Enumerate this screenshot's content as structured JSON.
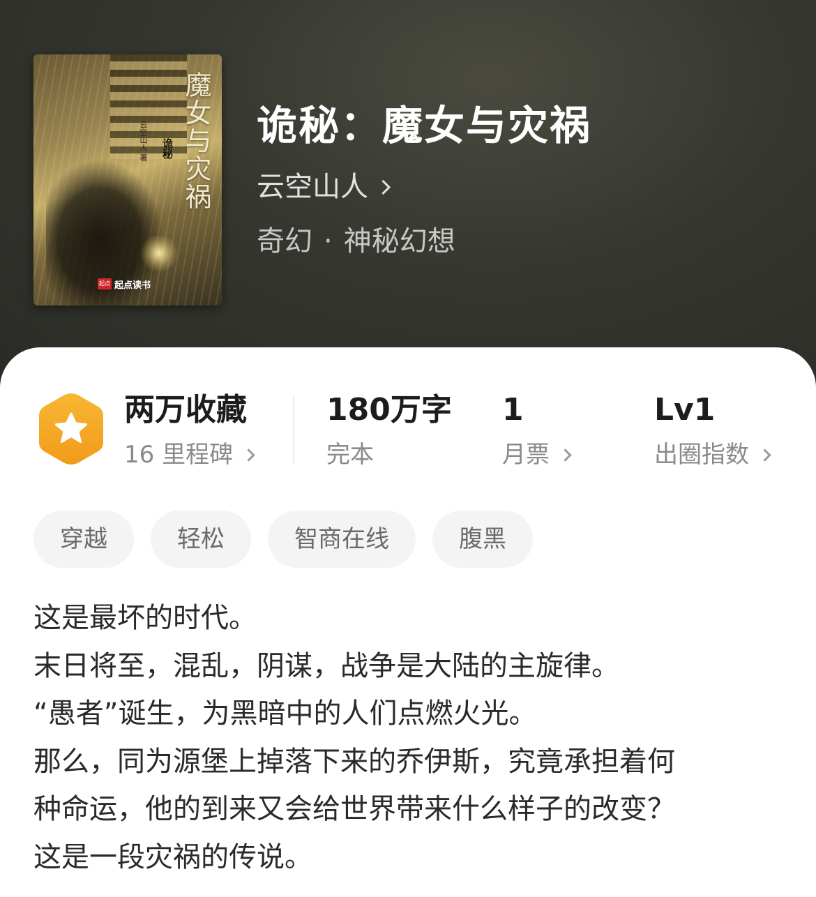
{
  "book": {
    "title": "诡秘：魔女与灾祸",
    "author": "云空山人",
    "category": "奇幻",
    "subcategory": "神秘幻想",
    "separator": "·"
  },
  "cover": {
    "title_text": "魔女与灾祸",
    "series_text": "诡秘",
    "author_text": "云空山人 著",
    "logo_badge": "起点",
    "logo_text": "起点读书"
  },
  "stats": {
    "collection": {
      "value": "两万收藏",
      "label": "16 里程碑"
    },
    "words": {
      "value": "180万字",
      "label": "完本"
    },
    "monthly_ticket": {
      "value": "1",
      "label": "月票"
    },
    "popularity": {
      "value": "Lv1",
      "label": "出圈指数"
    }
  },
  "tags": [
    "穿越",
    "轻松",
    "智商在线",
    "腹黑"
  ],
  "description": [
    "这是最坏的时代。",
    "末日将至，混乱，阴谋，战争是大陆的主旋律。",
    "“愚者”诞生，为黑暗中的人们点燃火光。",
    "那么，同为源堡上掉落下来的乔伊斯，究竟承担着何",
    "种命运，他的到来又会给世界带来什么样子的改变？",
    "这是一段灾祸的传说。"
  ],
  "colors": {
    "hero_bg": "#35362f",
    "badge_orange": "#f5a524",
    "text_dark": "#1c1c1c",
    "text_muted": "#8a8a8a",
    "tag_bg": "#f4f4f4"
  },
  "icons": {
    "badge": "star-hexagon-icon",
    "arrow": "chevron-right-icon"
  }
}
